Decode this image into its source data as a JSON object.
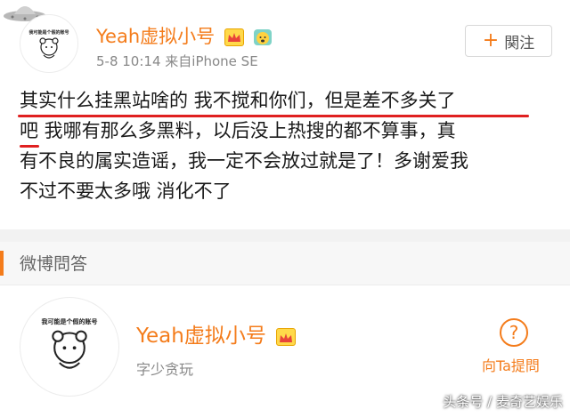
{
  "post": {
    "user_name": "Yeah虚拟小号",
    "avatar_caption": "我可能是个假的账号",
    "time": "5-8 10:14",
    "source": "来自iPhone SE",
    "follow_label": "関注",
    "follow_plus": "+",
    "content_lines": [
      "其实什么挂黑站啥的 我不搅和你们，但是差不多关了",
      "吧 我哪有那么多黑料，以后没上热搜的都不算事，真",
      "有不良的属实造谣，我一定不会放过就是了！多谢爱我",
      "不过不要太多哦 消化不了"
    ],
    "underline_color": "#e02020"
  },
  "qa": {
    "section_title": "微博問答",
    "user_name": "Yeah虚拟小号",
    "avatar_caption": "我可能是个假的账号",
    "subtitle": "字少贪玩",
    "ask_label": "向Ta提問",
    "ask_icon": "?"
  },
  "watermark": "头条号 / 麦奇艺娱乐",
  "colors": {
    "accent": "#f47c1b",
    "text": "#1a1a1a",
    "muted": "#888888"
  }
}
